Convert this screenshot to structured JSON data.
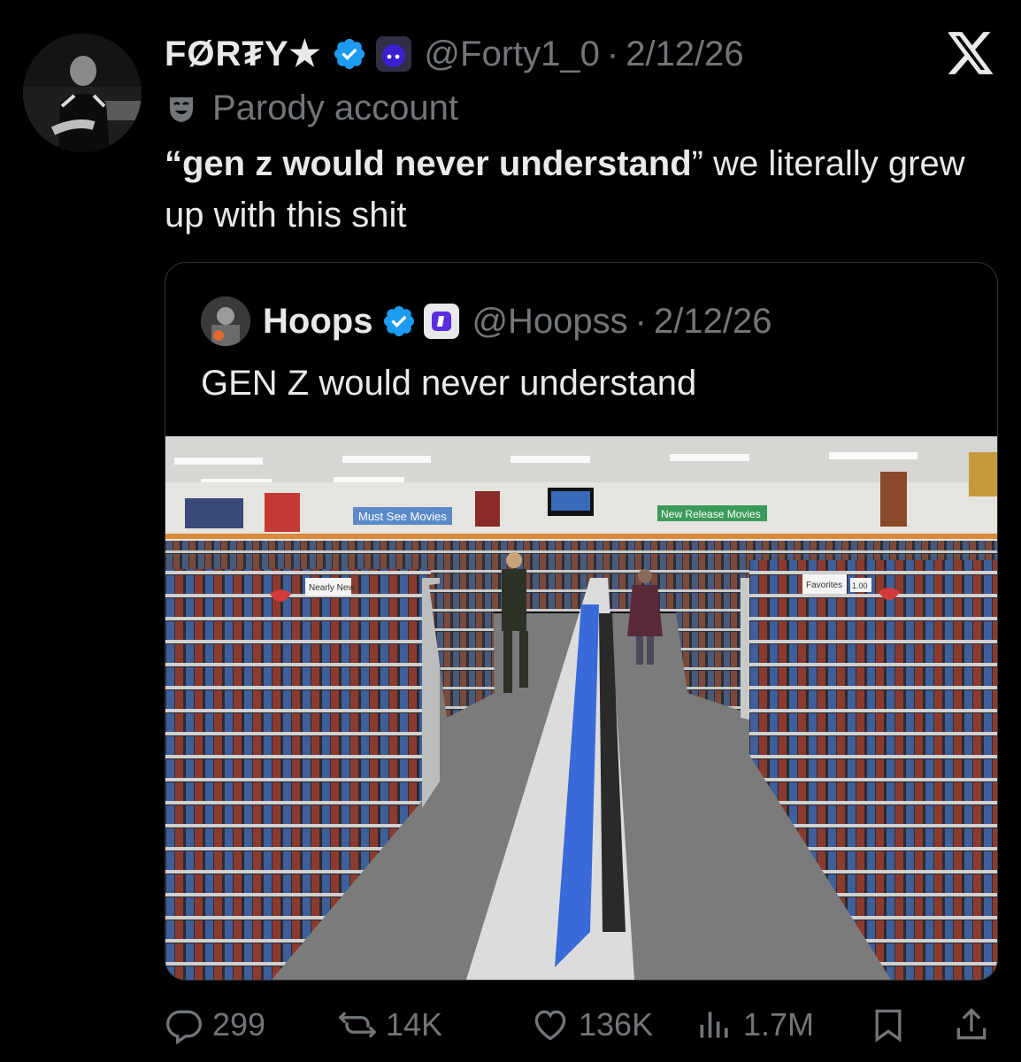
{
  "tweet": {
    "display_name": "FØR₮Y★",
    "handle": "@Forty1_0",
    "separator": "·",
    "date": "2/12/26",
    "label": "Parody account",
    "text_quote_open": "“",
    "text_bold": "gen z would never understand",
    "text_quote_close": "”",
    "text_rest": " we literally grew up with this shit"
  },
  "quote": {
    "display_name": "Hoops",
    "handle": "@Hoopss",
    "separator": "·",
    "date": "2/12/26",
    "text": "GEN Z would never understand",
    "signs": {
      "must_see": "Must See Movies",
      "new_release": "New Release Movies",
      "nearly_new": "Nearly New",
      "favorites": "Favorites",
      "price": "1.00"
    }
  },
  "actions": {
    "replies": "299",
    "reposts": "14K",
    "likes": "136K",
    "views": "1.7M"
  },
  "icons": {
    "verified": "verified-badge-icon",
    "affiliate": "affiliate-badge-icon",
    "parody": "parody-mask-icon",
    "x_logo": "x-logo-icon",
    "reply": "reply-icon",
    "repost": "repost-icon",
    "like": "heart-icon",
    "views": "views-chart-icon",
    "bookmark": "bookmark-icon",
    "share": "share-icon"
  },
  "colors": {
    "background": "#000000",
    "text": "#e7e9ea",
    "muted": "#71767b",
    "verified": "#1d9bf0",
    "border": "#2f3336"
  }
}
